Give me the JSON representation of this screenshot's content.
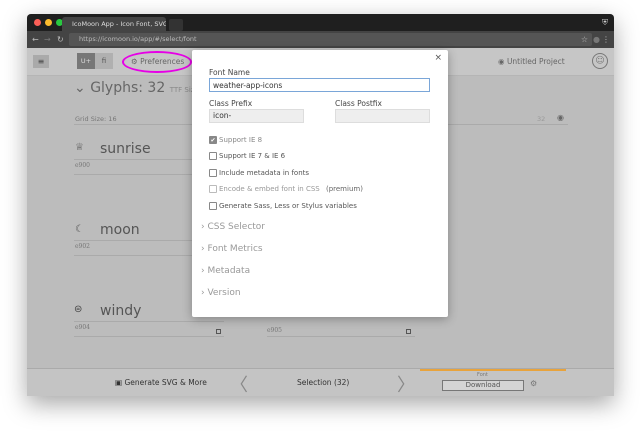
{
  "browser": {
    "tab_title": "IcoMoon App - Icon Font, SVG",
    "url": "https://icomoon.io/app/#/select/font"
  },
  "header": {
    "unicode_btn": "U+",
    "ligature_btn": "fi",
    "preferences": "Preferences",
    "project": "Untitled Project"
  },
  "content": {
    "glyphs_title": "Glyphs: 32",
    "ttf_size": "TTF Size",
    "grid_size": "Grid Size: 16",
    "grid_value": "32",
    "glyphs": [
      {
        "name": "sunrise",
        "code": "e900",
        "icon": "sunrise-icon"
      },
      {
        "name": "moon",
        "code": "e902",
        "icon": "moon-icon"
      },
      {
        "name": "windy",
        "code": "e904",
        "icon": "windy-icon"
      }
    ],
    "extra_code": "e905"
  },
  "modal": {
    "font_name_label": "Font Name",
    "font_name_value": "weather-app-icons",
    "class_prefix_label": "Class Prefix",
    "class_prefix_value": "icon-",
    "class_postfix_label": "Class Postfix",
    "class_postfix_value": "",
    "options": [
      {
        "label": "Support IE 8",
        "checked": true,
        "disabled": true
      },
      {
        "label": "Support IE 7 & IE 6",
        "checked": false
      },
      {
        "label": "Include metadata in fonts",
        "checked": false
      },
      {
        "label": "Encode & embed font in CSS",
        "suffix": "(premium)",
        "checked": false,
        "disabled": true
      },
      {
        "label": "Generate Sass, Less or Stylus variables",
        "checked": false
      }
    ],
    "sections": [
      "CSS Selector",
      "Font Metrics",
      "Metadata",
      "Version"
    ]
  },
  "bottom": {
    "generate": "Generate SVG & More",
    "selection": "Selection (32)",
    "font_label": "Font",
    "download": "Download"
  },
  "colors": {
    "highlight": "#e600e6",
    "accent": "#e8a33c"
  }
}
